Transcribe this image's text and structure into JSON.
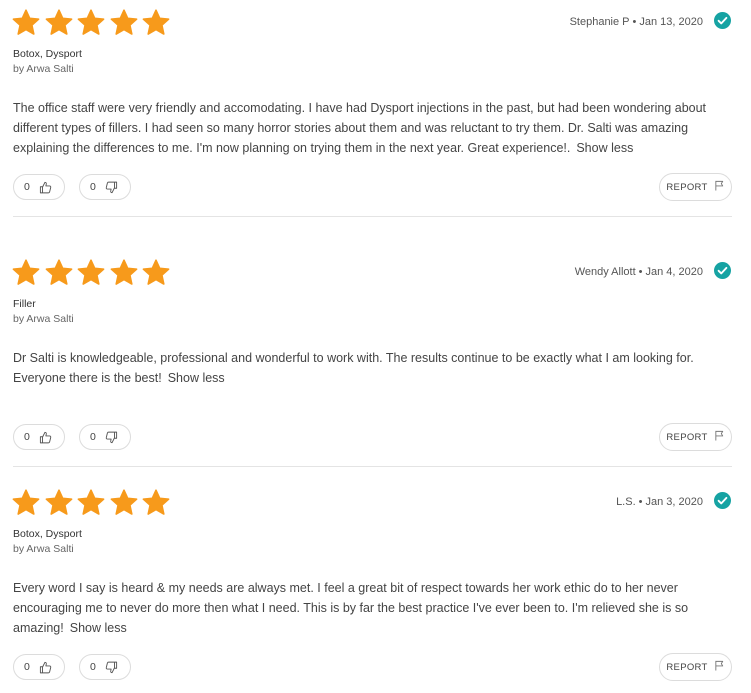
{
  "colors": {
    "star": "#f79a1b",
    "verified": "#16a3a3",
    "border": "#dcdcdc"
  },
  "icons": {
    "star": "star-icon",
    "verified": "check-circle-icon",
    "helpful": "thumbs-up-icon",
    "unhelpful": "thumbs-down-icon",
    "report": "flag-icon"
  },
  "reviews": [
    {
      "rating": 5,
      "author": "Stephanie P",
      "date": "Jan 13, 2020",
      "treatments": "Botox, Dysport",
      "provider": "by Arwa Salti",
      "text": "The office staff were very friendly and accomodating. I have had Dysport injections in the past, but had been wondering about different types of fillers. I had seen so many horror stories about them and was reluctant to try them. Dr. Salti was amazing explaining the differences to me. I'm now planning on trying them in the next year. Great experience!.",
      "show_less": "Show less",
      "helpful_count": "0",
      "unhelpful_count": "0",
      "report_label": "REPORT"
    },
    {
      "rating": 5,
      "author": "Wendy Allott",
      "date": "Jan 4, 2020",
      "treatments": "Filler",
      "provider": "by Arwa Salti",
      "text": "Dr Salti is knowledgeable, professional and wonderful to work with. The results continue to be exactly what I am looking for. Everyone there is the best!",
      "show_less": "Show less",
      "helpful_count": "0",
      "unhelpful_count": "0",
      "report_label": "REPORT"
    },
    {
      "rating": 5,
      "author": "L.S.",
      "date": "Jan 3, 2020",
      "treatments": "Botox, Dysport",
      "provider": "by Arwa Salti",
      "text": "Every word I say is heard & my needs are always met. I feel a great bit of respect towards her work ethic do to her never encouraging me to never do more then what I need. This is by far the best practice I've ever been to. I'm relieved she is so amazing!",
      "show_less": "Show less",
      "helpful_count": "0",
      "unhelpful_count": "0",
      "report_label": "REPORT"
    }
  ],
  "separator": "•"
}
